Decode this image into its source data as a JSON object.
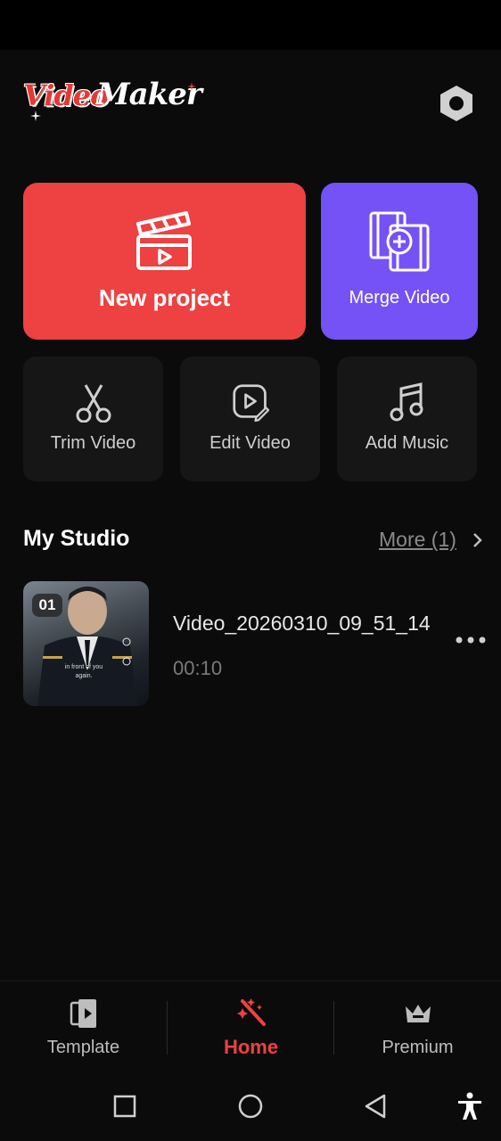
{
  "header": {
    "logo_video": "Video",
    "logo_maker": "Maker",
    "settings_icon": "hexagon-settings-icon"
  },
  "actions": {
    "new_project": {
      "label": "New project",
      "icon": "clapperboard-icon",
      "color": "#ee4141"
    },
    "merge_video": {
      "label": "Merge Video",
      "icon": "merge-film-icon",
      "color": "#7452f5"
    }
  },
  "tools": [
    {
      "label": "Trim Video",
      "icon": "scissors-icon"
    },
    {
      "label": "Edit Video",
      "icon": "edit-video-icon"
    },
    {
      "label": "Add Music",
      "icon": "music-note-icon"
    }
  ],
  "studio": {
    "title": "My Studio",
    "more_label": "More (1)",
    "videos": [
      {
        "badge": "01",
        "name": "Video_20260310_09_51_14",
        "duration": "00:10",
        "caption": "in front of you again."
      }
    ]
  },
  "bottom_nav": {
    "items": [
      {
        "label": "Template",
        "icon": "template-icon",
        "active": false
      },
      {
        "label": "Home",
        "icon": "magic-wand-icon",
        "active": true
      },
      {
        "label": "Premium",
        "icon": "crown-icon",
        "active": false
      }
    ],
    "active_color": "#ee4141"
  },
  "system_nav": {
    "buttons": [
      "recents-icon",
      "home-icon",
      "back-icon",
      "accessibility-icon"
    ]
  }
}
